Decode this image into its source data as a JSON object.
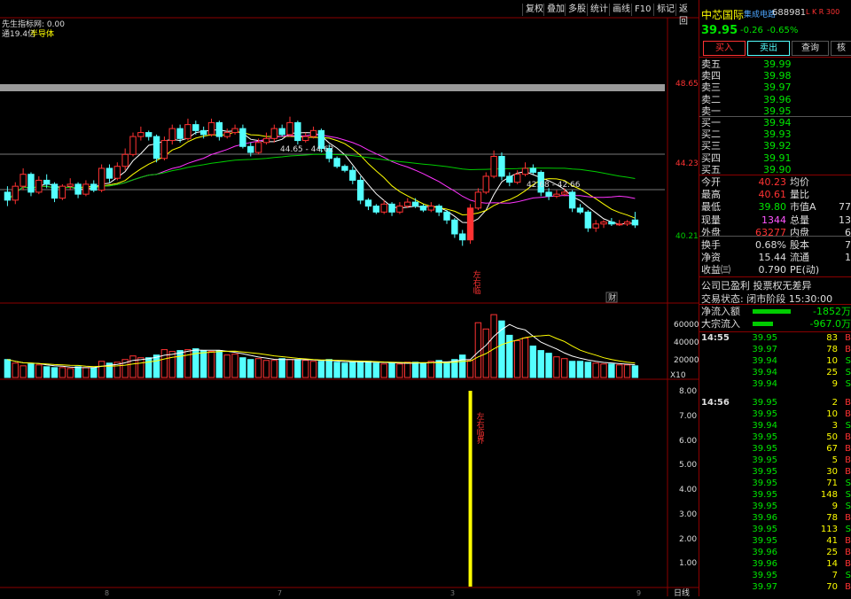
{
  "toolbar": {
    "indicator_title": "先生指标网: 0.00",
    "sub_line_left": "通19.4亿",
    "sub_line_right": "半导体",
    "buttons": [
      "复权",
      "叠加",
      "多股",
      "统计",
      "画线",
      "F10",
      "标记",
      "返回"
    ]
  },
  "price_axis": {
    "labels": [
      "48.65",
      "44.23",
      "40.21"
    ]
  },
  "chart_annotations": {
    "high_marker": "44.65 - 44.62",
    "second_marker": "42.68 - 42.66",
    "signal_vertical_text": "左右临",
    "cai_badge": "财"
  },
  "volume_axis": {
    "labels": [
      "60000",
      "40000",
      "20000"
    ],
    "unit": "X10"
  },
  "indicator_axis": {
    "labels": [
      "8.00",
      "7.00",
      "6.00",
      "5.00",
      "4.00",
      "3.00",
      "2.00",
      "1.00"
    ]
  },
  "indicator_annotation": "左右临界",
  "bottom_axis": {
    "labels": [
      "8",
      "7",
      "3",
      "9"
    ],
    "right_label": "日线"
  },
  "colors": {
    "up": "#ff3232",
    "down": "#54ffff",
    "ma5": "#ffffff",
    "ma10": "#ffff00",
    "ma20": "#ff33ff",
    "ma60": "#00cc00",
    "signal": "#ffff00",
    "frame": "#8b0000"
  },
  "stock": {
    "name": "中芯国际",
    "sector": "集成电路",
    "code": "688981",
    "tags": "L K R 300",
    "price": "39.95",
    "change": "-0.26",
    "change_pct": "-0.65%"
  },
  "actions": {
    "buy": "买入",
    "sell": "卖出",
    "query": "查询",
    "more": "核"
  },
  "order_book": {
    "asks": [
      {
        "label": "卖五",
        "price": "39.99"
      },
      {
        "label": "卖四",
        "price": "39.98"
      },
      {
        "label": "卖三",
        "price": "39.97"
      },
      {
        "label": "卖二",
        "price": "39.96"
      },
      {
        "label": "卖一",
        "price": "39.95"
      }
    ],
    "bids": [
      {
        "label": "买一",
        "price": "39.94"
      },
      {
        "label": "买二",
        "price": "39.93"
      },
      {
        "label": "买三",
        "price": "39.92"
      },
      {
        "label": "买四",
        "price": "39.91"
      },
      {
        "label": "买五",
        "price": "39.90"
      }
    ]
  },
  "quote": [
    {
      "l1": "今开",
      "v1": "40.23",
      "l2": "均价",
      "v2": ""
    },
    {
      "l1": "最高",
      "v1": "40.61",
      "l2": "量比",
      "v2": ""
    },
    {
      "l1": "最低",
      "v1": "39.80",
      "l2": "市值A",
      "v2": "77"
    },
    {
      "l1": "现量",
      "v1": "1344",
      "l2": "总量",
      "v2": "13"
    },
    {
      "l1": "外盘",
      "v1": "63277",
      "l2": "内盘",
      "v2": "6"
    },
    {
      "l1": "换手",
      "v1": "0.68%",
      "l2": "股本",
      "v2": "7"
    },
    {
      "l1": "净资",
      "v1": "15.44",
      "l2": "流通",
      "v2": "1"
    },
    {
      "l1": "收益㈢",
      "v1": "0.790",
      "l2": "PE(动)",
      "v2": ""
    }
  ],
  "info": {
    "profit": "公司已盈利 投票权无差异",
    "trade_state": "交易状态: 闭市阶段 15:30:00"
  },
  "flow": [
    {
      "label": "净流入额",
      "value": "-1852万",
      "bar": 0.85
    },
    {
      "label": "大宗流入",
      "value": "-967.0万",
      "bar": 0.45
    }
  ],
  "ticks": [
    {
      "time": "14:55",
      "price": "39.95",
      "vol": "83",
      "side": "B",
      "c": "red"
    },
    {
      "time": "",
      "price": "39.97",
      "vol": "78",
      "side": "B",
      "c": "red"
    },
    {
      "time": "",
      "price": "39.94",
      "vol": "10",
      "side": "S",
      "c": "grn"
    },
    {
      "time": "",
      "price": "39.94",
      "vol": "25",
      "side": "S",
      "c": "grn"
    },
    {
      "time": "",
      "price": "39.94",
      "vol": "9",
      "side": "S",
      "c": "grn"
    },
    {
      "time": "14:56",
      "price": "39.95",
      "vol": "2",
      "side": "B",
      "c": "red"
    },
    {
      "time": "",
      "price": "39.95",
      "vol": "10",
      "side": "B",
      "c": "red"
    },
    {
      "time": "",
      "price": "39.94",
      "vol": "3",
      "side": "S",
      "c": "grn"
    },
    {
      "time": "",
      "price": "39.95",
      "vol": "50",
      "side": "B",
      "c": "red"
    },
    {
      "time": "",
      "price": "39.95",
      "vol": "67",
      "side": "B",
      "c": "red"
    },
    {
      "time": "",
      "price": "39.95",
      "vol": "5",
      "side": "B",
      "c": "red"
    },
    {
      "time": "",
      "price": "39.95",
      "vol": "30",
      "side": "B",
      "c": "red"
    },
    {
      "time": "",
      "price": "39.95",
      "vol": "71",
      "side": "S",
      "c": "grn"
    },
    {
      "time": "",
      "price": "39.95",
      "vol": "148",
      "side": "S",
      "c": "grn"
    },
    {
      "time": "",
      "price": "39.95",
      "vol": "9",
      "side": "S",
      "c": "grn"
    },
    {
      "time": "",
      "price": "39.96",
      "vol": "78",
      "side": "B",
      "c": "red"
    },
    {
      "time": "",
      "price": "39.95",
      "vol": "113",
      "side": "S",
      "c": "grn"
    },
    {
      "time": "",
      "price": "39.95",
      "vol": "41",
      "side": "B",
      "c": "red"
    },
    {
      "time": "",
      "price": "39.96",
      "vol": "25",
      "side": "B",
      "c": "red"
    },
    {
      "time": "",
      "price": "39.96",
      "vol": "14",
      "side": "B",
      "c": "red"
    },
    {
      "time": "",
      "price": "39.95",
      "vol": "7",
      "side": "S",
      "c": "grn"
    },
    {
      "time": "",
      "price": "39.97",
      "vol": "70",
      "side": "B",
      "c": "red"
    }
  ],
  "candles": [
    {
      "o": 41.6,
      "c": 41.2,
      "h": 41.9,
      "l": 40.9
    },
    {
      "o": 41.2,
      "c": 41.9,
      "h": 42.1,
      "l": 41.0
    },
    {
      "o": 41.9,
      "c": 42.5,
      "h": 42.8,
      "l": 41.7
    },
    {
      "o": 42.5,
      "c": 41.6,
      "h": 42.6,
      "l": 41.4
    },
    {
      "o": 41.6,
      "c": 42.2,
      "h": 42.4,
      "l": 41.5
    },
    {
      "o": 42.2,
      "c": 42.0,
      "h": 42.5,
      "l": 41.8
    },
    {
      "o": 42.0,
      "c": 41.3,
      "h": 42.1,
      "l": 41.1
    },
    {
      "o": 41.3,
      "c": 41.9,
      "h": 42.0,
      "l": 41.2
    },
    {
      "o": 41.9,
      "c": 42.0,
      "h": 42.3,
      "l": 41.7
    },
    {
      "o": 42.0,
      "c": 41.5,
      "h": 42.1,
      "l": 41.3
    },
    {
      "o": 41.5,
      "c": 42.0,
      "h": 42.2,
      "l": 41.4
    },
    {
      "o": 42.0,
      "c": 41.7,
      "h": 42.2,
      "l": 41.6
    },
    {
      "o": 41.7,
      "c": 42.8,
      "h": 43.0,
      "l": 41.6
    },
    {
      "o": 42.8,
      "c": 42.3,
      "h": 43.0,
      "l": 42.1
    },
    {
      "o": 42.3,
      "c": 42.9,
      "h": 43.1,
      "l": 42.2
    },
    {
      "o": 42.9,
      "c": 43.5,
      "h": 43.8,
      "l": 42.7
    },
    {
      "o": 43.5,
      "c": 44.4,
      "h": 44.6,
      "l": 43.4
    },
    {
      "o": 44.4,
      "c": 44.6,
      "h": 44.9,
      "l": 44.2
    },
    {
      "o": 44.6,
      "c": 44.4,
      "h": 44.7,
      "l": 44.2
    },
    {
      "o": 44.4,
      "c": 43.3,
      "h": 44.5,
      "l": 43.1
    },
    {
      "o": 43.3,
      "c": 44.2,
      "h": 44.4,
      "l": 43.2
    },
    {
      "o": 44.2,
      "c": 44.8,
      "h": 45.0,
      "l": 44.0
    },
    {
      "o": 44.8,
      "c": 44.3,
      "h": 45.0,
      "l": 44.1
    },
    {
      "o": 44.3,
      "c": 45.0,
      "h": 45.3,
      "l": 44.2
    },
    {
      "o": 45.0,
      "c": 44.7,
      "h": 45.2,
      "l": 44.5
    },
    {
      "o": 44.7,
      "c": 44.5,
      "h": 44.9,
      "l": 44.3
    },
    {
      "o": 44.5,
      "c": 45.1,
      "h": 45.3,
      "l": 44.4
    },
    {
      "o": 45.1,
      "c": 44.4,
      "h": 45.2,
      "l": 44.2
    },
    {
      "o": 44.4,
      "c": 44.6,
      "h": 44.8,
      "l": 44.3
    },
    {
      "o": 44.6,
      "c": 44.8,
      "h": 45.0,
      "l": 44.5
    },
    {
      "o": 44.8,
      "c": 43.9,
      "h": 45.0,
      "l": 43.8
    },
    {
      "o": 43.9,
      "c": 43.6,
      "h": 44.1,
      "l": 43.4
    },
    {
      "o": 43.6,
      "c": 44.1,
      "h": 44.3,
      "l": 43.5
    },
    {
      "o": 44.1,
      "c": 44.3,
      "h": 44.6,
      "l": 44.0
    },
    {
      "o": 44.3,
      "c": 44.8,
      "h": 45.0,
      "l": 44.1
    },
    {
      "o": 44.8,
      "c": 44.5,
      "h": 45.0,
      "l": 44.4
    },
    {
      "o": 44.5,
      "c": 45.1,
      "h": 45.4,
      "l": 44.4
    },
    {
      "o": 45.1,
      "c": 44.2,
      "h": 45.2,
      "l": 44.0
    },
    {
      "o": 44.2,
      "c": 44.4,
      "h": 44.6,
      "l": 44.1
    },
    {
      "o": 44.4,
      "c": 44.7,
      "h": 44.9,
      "l": 44.3
    },
    {
      "o": 44.7,
      "c": 43.8,
      "h": 44.8,
      "l": 43.6
    },
    {
      "o": 43.8,
      "c": 43.3,
      "h": 44.0,
      "l": 43.1
    },
    {
      "o": 43.3,
      "c": 42.9,
      "h": 43.4,
      "l": 42.8
    },
    {
      "o": 42.9,
      "c": 42.7,
      "h": 43.0,
      "l": 42.6
    },
    {
      "o": 42.7,
      "c": 42.2,
      "h": 42.9,
      "l": 42.0
    },
    {
      "o": 42.2,
      "c": 41.2,
      "h": 42.4,
      "l": 41.0
    },
    {
      "o": 41.2,
      "c": 40.9,
      "h": 41.3,
      "l": 40.7
    },
    {
      "o": 40.9,
      "c": 40.6,
      "h": 41.0,
      "l": 40.5
    },
    {
      "o": 40.6,
      "c": 41.0,
      "h": 41.2,
      "l": 40.5
    },
    {
      "o": 41.0,
      "c": 40.6,
      "h": 41.1,
      "l": 40.4
    },
    {
      "o": 40.6,
      "c": 40.9,
      "h": 41.1,
      "l": 40.5
    },
    {
      "o": 40.9,
      "c": 41.1,
      "h": 41.3,
      "l": 40.8
    },
    {
      "o": 41.1,
      "c": 40.9,
      "h": 41.3,
      "l": 40.8
    },
    {
      "o": 40.9,
      "c": 40.7,
      "h": 41.0,
      "l": 40.6
    },
    {
      "o": 40.7,
      "c": 40.9,
      "h": 41.1,
      "l": 40.6
    },
    {
      "o": 40.9,
      "c": 40.6,
      "h": 41.0,
      "l": 40.4
    },
    {
      "o": 40.6,
      "c": 40.2,
      "h": 40.7,
      "l": 40.0
    },
    {
      "o": 40.2,
      "c": 39.5,
      "h": 40.3,
      "l": 39.3
    },
    {
      "o": 39.5,
      "c": 39.2,
      "h": 39.7,
      "l": 38.9
    },
    {
      "o": 39.2,
      "c": 40.8,
      "h": 41.0,
      "l": 39.0
    },
    {
      "o": 40.8,
      "c": 41.6,
      "h": 41.8,
      "l": 40.7
    },
    {
      "o": 41.6,
      "c": 42.4,
      "h": 42.6,
      "l": 41.5
    },
    {
      "o": 42.4,
      "c": 43.4,
      "h": 43.7,
      "l": 42.3
    },
    {
      "o": 43.4,
      "c": 42.4,
      "h": 43.6,
      "l": 42.2
    },
    {
      "o": 42.4,
      "c": 42.1,
      "h": 42.6,
      "l": 41.9
    },
    {
      "o": 42.1,
      "c": 42.5,
      "h": 42.7,
      "l": 42.0
    },
    {
      "o": 42.5,
      "c": 42.8,
      "h": 43.1,
      "l": 42.4
    },
    {
      "o": 42.8,
      "c": 42.6,
      "h": 43.0,
      "l": 42.5
    },
    {
      "o": 42.6,
      "c": 41.6,
      "h": 42.7,
      "l": 41.4
    },
    {
      "o": 41.6,
      "c": 41.4,
      "h": 41.8,
      "l": 41.2
    },
    {
      "o": 41.4,
      "c": 41.5,
      "h": 41.7,
      "l": 41.3
    },
    {
      "o": 41.5,
      "c": 41.6,
      "h": 41.8,
      "l": 41.4
    },
    {
      "o": 41.6,
      "c": 40.8,
      "h": 41.7,
      "l": 40.6
    },
    {
      "o": 40.8,
      "c": 40.6,
      "h": 41.0,
      "l": 40.5
    },
    {
      "o": 40.6,
      "c": 39.8,
      "h": 40.7,
      "l": 39.6
    },
    {
      "o": 39.8,
      "c": 40.0,
      "h": 40.2,
      "l": 39.6
    },
    {
      "o": 40.0,
      "c": 40.1,
      "h": 40.2,
      "l": 39.8
    },
    {
      "o": 40.1,
      "c": 40.0,
      "h": 40.3,
      "l": 39.9
    },
    {
      "o": 40.0,
      "c": 40.0,
      "h": 40.2,
      "l": 39.9
    },
    {
      "o": 40.0,
      "c": 40.1,
      "h": 40.2,
      "l": 39.9
    },
    {
      "o": 40.2,
      "c": 39.95,
      "h": 40.61,
      "l": 39.8
    }
  ],
  "volumes": [
    20,
    16,
    13,
    15,
    14,
    12,
    11,
    11,
    10,
    12,
    11,
    11,
    18,
    16,
    17,
    20,
    24,
    22,
    22,
    25,
    31,
    29,
    30,
    31,
    32,
    30,
    29,
    30,
    25,
    26,
    22,
    20,
    21,
    19,
    19,
    21,
    20,
    20,
    19,
    18,
    18,
    20,
    17,
    16,
    17,
    18,
    18,
    16,
    15,
    16,
    15,
    17,
    17,
    16,
    18,
    19,
    17,
    20,
    25,
    19,
    61,
    54,
    70,
    63,
    47,
    41,
    44,
    35,
    30,
    27,
    23,
    21,
    18,
    18,
    17,
    16,
    15,
    15,
    14,
    14,
    13
  ],
  "signal_index": 59
}
